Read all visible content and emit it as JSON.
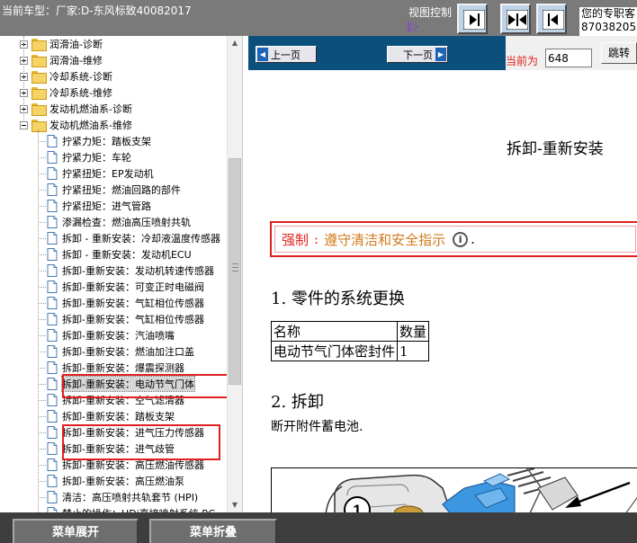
{
  "header": {
    "vehicle_label": "当前车型：厂家:D-东风标致40082017",
    "view_control_label": "视图控制",
    "view_control_icon": "view-toggle-icon",
    "view_buttons": [
      {
        "name": "collapse-left-icon"
      },
      {
        "name": "split-view-icon"
      },
      {
        "name": "collapse-right-icon"
      }
    ],
    "contact_line1": "您的专职客",
    "contact_line2": "87038205"
  },
  "sidebar": {
    "items": [
      {
        "label": "润滑油-诊断",
        "type": "folder",
        "expander": "plus"
      },
      {
        "label": "润滑油-维修",
        "type": "folder",
        "expander": "plus"
      },
      {
        "label": "冷却系统-诊断",
        "type": "folder",
        "expander": "plus"
      },
      {
        "label": "冷却系统-维修",
        "type": "folder",
        "expander": "plus"
      },
      {
        "label": "发动机燃油系-诊断",
        "type": "folder",
        "expander": "plus"
      },
      {
        "label": "发动机燃油系-维修",
        "type": "folder",
        "expander": "minus"
      },
      {
        "label": "拧紧力矩：踏板支架",
        "type": "doc"
      },
      {
        "label": "拧紧力矩：车轮",
        "type": "doc"
      },
      {
        "label": "拧紧扭矩：EP发动机",
        "type": "doc"
      },
      {
        "label": "拧紧扭矩：燃油回路的部件",
        "type": "doc"
      },
      {
        "label": "拧紧扭矩：进气管路",
        "type": "doc"
      },
      {
        "label": "渗漏检查：燃油高压喷射共轨",
        "type": "doc"
      },
      {
        "label": "拆卸 - 重新安装：冷却液温度传感器",
        "type": "doc"
      },
      {
        "label": "拆卸 - 重新安装：发动机ECU",
        "type": "doc"
      },
      {
        "label": "拆卸-重新安装：发动机转速传感器",
        "type": "doc"
      },
      {
        "label": "拆卸-重新安装：可变正时电磁阀",
        "type": "doc"
      },
      {
        "label": "拆卸-重新安装：气缸相位传感器",
        "type": "doc"
      },
      {
        "label": "拆卸-重新安装：气缸相位传感器",
        "type": "doc"
      },
      {
        "label": "拆卸-重新安装：汽油喷嘴",
        "type": "doc"
      },
      {
        "label": "拆卸-重新安装：燃油加注口盖",
        "type": "doc"
      },
      {
        "label": "拆卸-重新安装：爆震探测器",
        "type": "doc"
      },
      {
        "label": "拆卸-重新安装：电动节气门体",
        "type": "doc",
        "selected": true
      },
      {
        "label": "拆卸-重新安装：空气滤清器",
        "type": "doc"
      },
      {
        "label": "拆卸-重新安装：踏板支架",
        "type": "doc"
      },
      {
        "label": "拆卸-重新安装：进气压力传感器",
        "type": "doc"
      },
      {
        "label": "拆卸-重新安装：进气歧管",
        "type": "doc"
      },
      {
        "label": "拆卸-重新安装：高压燃油传感器",
        "type": "doc"
      },
      {
        "label": "拆卸-重新安装：高压燃油泵",
        "type": "doc"
      },
      {
        "label": "清洁：高压喷射共轨套节 (HPI)",
        "type": "doc"
      },
      {
        "label": "禁止的操作：HDi直接喷射系统 RC",
        "type": "doc"
      }
    ]
  },
  "nav": {
    "prev_label": "上一页",
    "next_label": "下一页",
    "current_label": "当前为",
    "page_value": "648",
    "jump_label": "跳转"
  },
  "doc": {
    "title": "拆卸-重新安装",
    "warning_label": "强制",
    "warning_sep": ":",
    "warning_text": "遵守清洁和安全指示",
    "info_icon_text": "i",
    "warning_dot": ".",
    "section1": "1.  零件的系统更换",
    "table": {
      "headers": [
        "名称",
        "数量"
      ],
      "rows": [
        [
          "电动节气门体密封件",
          "1"
        ]
      ]
    },
    "section2": "2.  拆卸",
    "step1": "断开附件蓄电池.",
    "figure_callout": "1"
  },
  "footer": {
    "expand_label": "菜单展开",
    "collapse_label": "菜单折叠"
  },
  "colors": {
    "topbar": "#7a7a7a",
    "navbar": "#0b4f7c",
    "warning_red": "#e02020",
    "warning_text": "#d07a1c",
    "bottombar": "#3e3e3e"
  }
}
